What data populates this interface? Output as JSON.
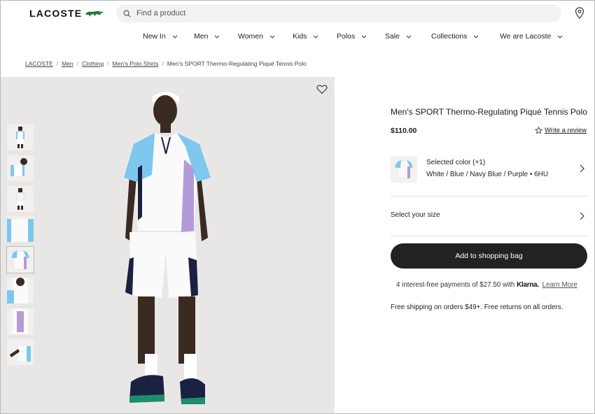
{
  "header": {
    "logo_text": "LACOSTE",
    "search_placeholder": "Find a product"
  },
  "nav": {
    "items": [
      "New In",
      "Men",
      "Women",
      "Kids",
      "Polos",
      "Sale",
      "Collections",
      "We are Lacoste"
    ]
  },
  "breadcrumb": {
    "items": [
      "LACOSTE",
      "Men",
      "Clothing",
      "Men's Polo Shirts"
    ],
    "current": "Men's SPORT Thermo-Regulating Piqué Tennis Polo"
  },
  "product": {
    "title": "Men's SPORT Thermo-Regulating Piqué Tennis Polo",
    "price": "$110.00",
    "write_review": "Write a review",
    "selected_color_label": "Selected color (+1)",
    "selected_color_value": "White / Blue / Navy Blue / Purple • 6HU",
    "select_size": "Select your size",
    "add_to_bag": "Add to shopping bag",
    "klarna_prefix": "4 interest-free payments of $27.50 with",
    "klarna_brand": "Klarna.",
    "klarna_link": "Learn More",
    "shipping": "Free shipping on orders $49+. Free returns on all orders."
  },
  "colors": {
    "brand_green": "#1d7a3a",
    "button_dark": "#222222",
    "shirt_blue": "#7ec7ee",
    "shirt_purple": "#b59ad8",
    "navy": "#1b2140",
    "gallery_bg": "#e9e7e6"
  }
}
